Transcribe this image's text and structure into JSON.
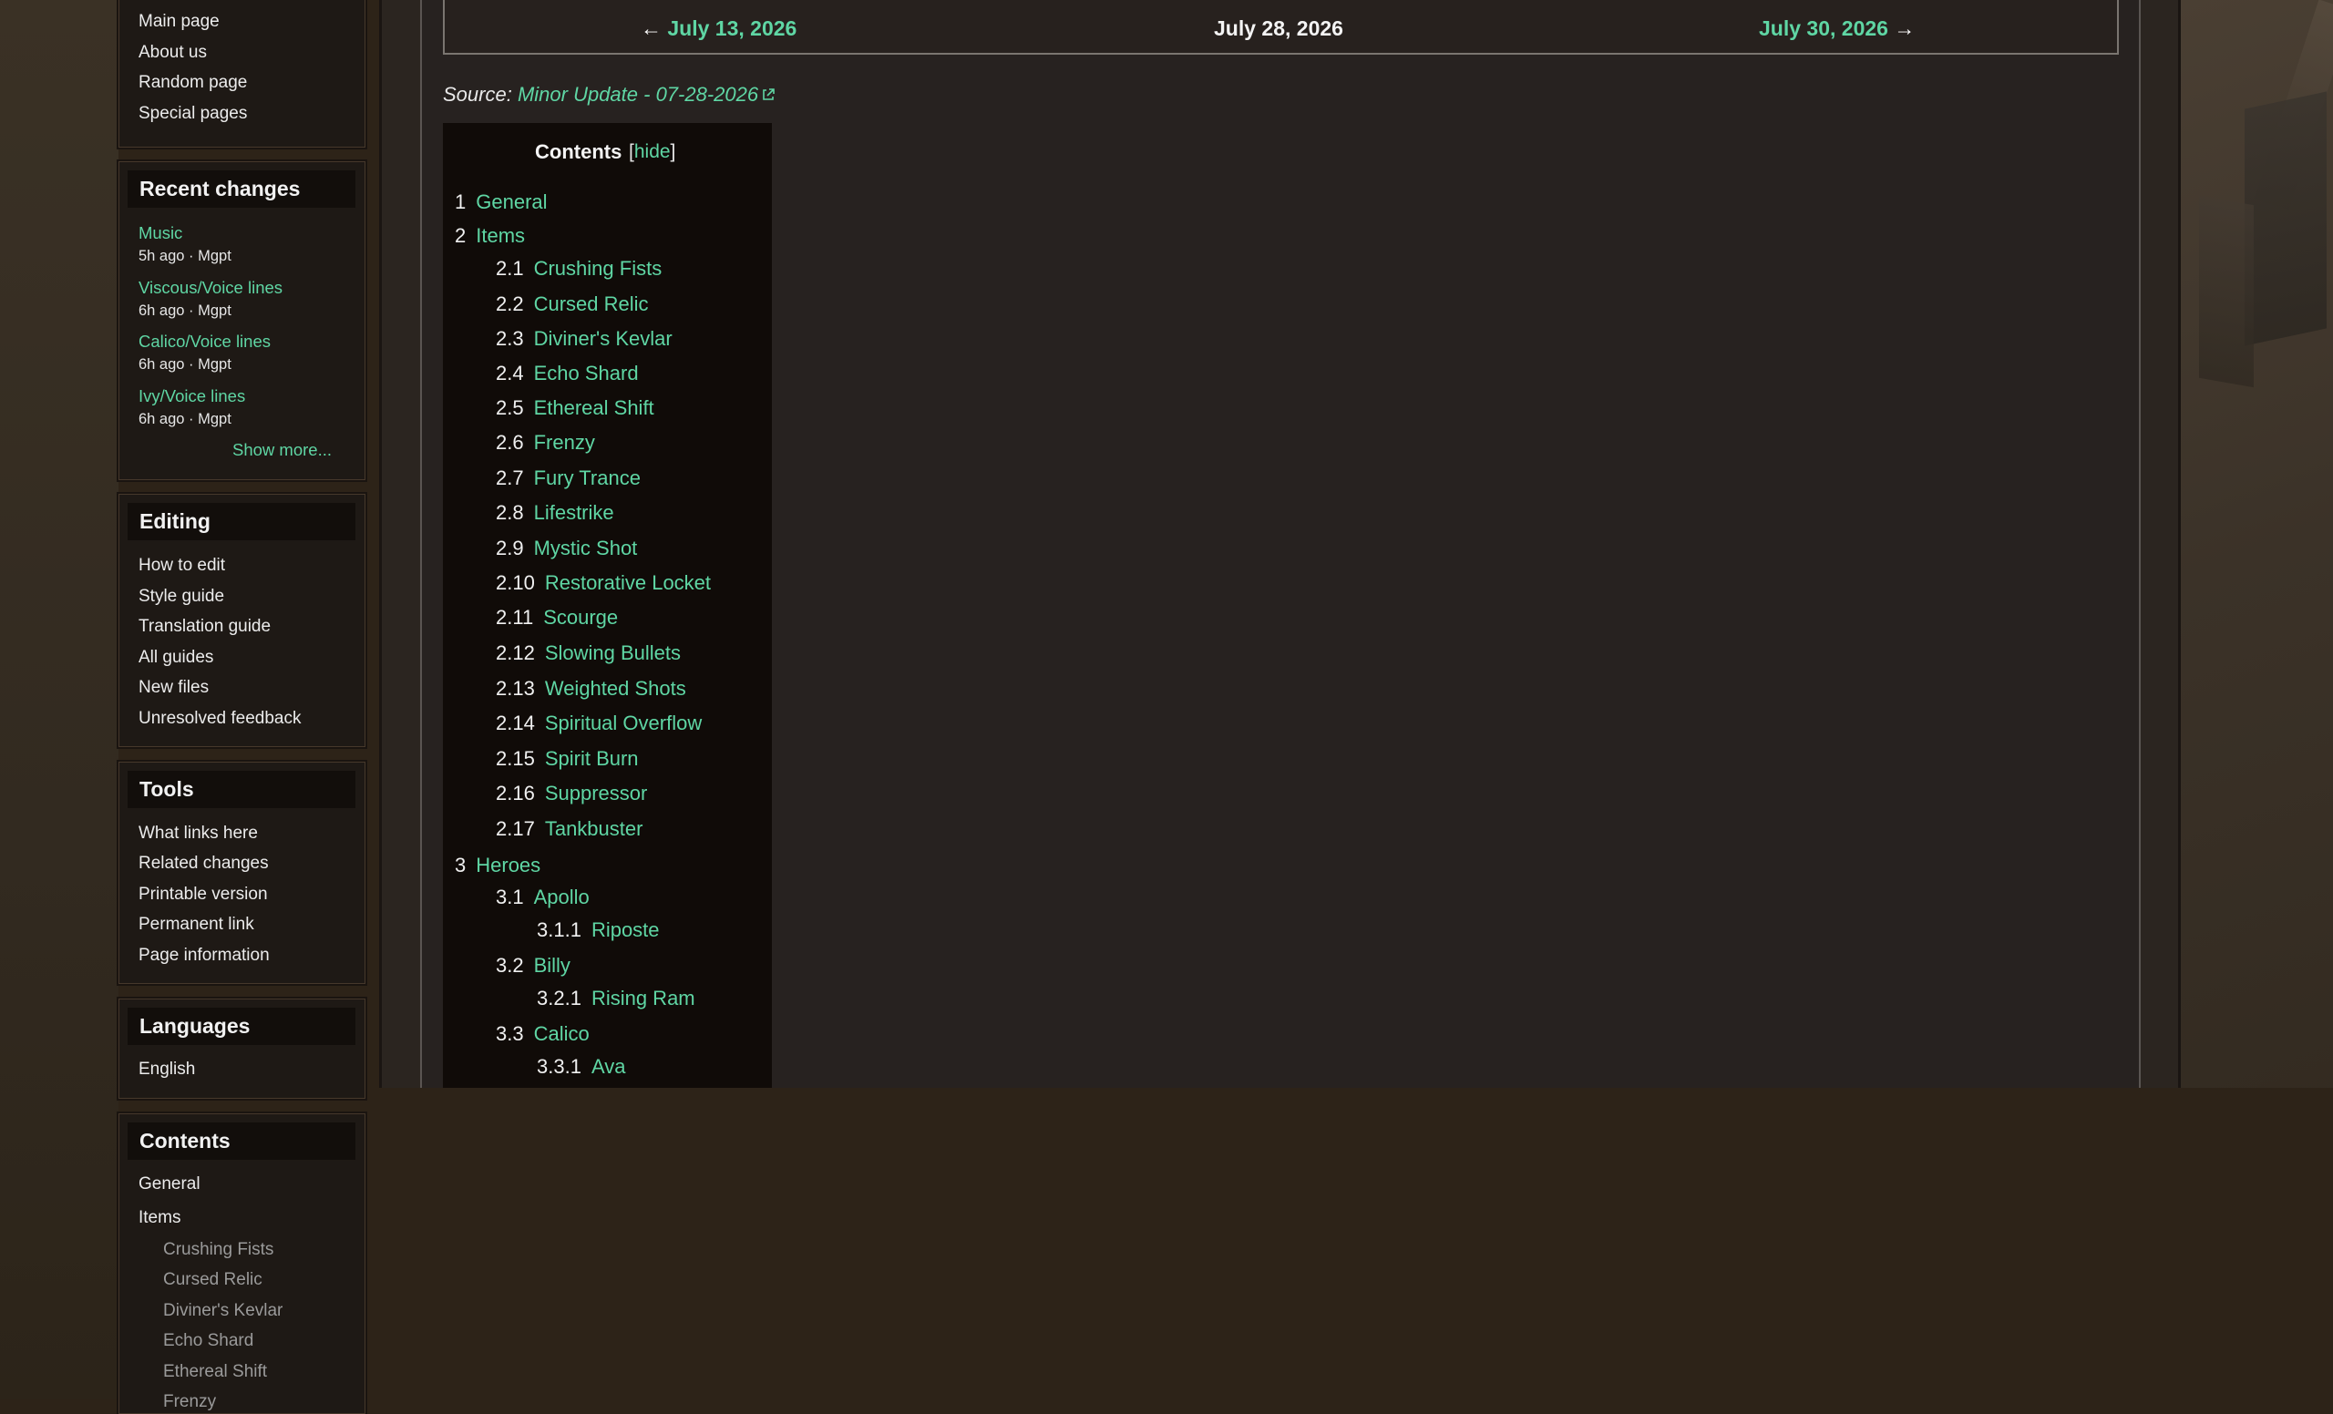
{
  "sidebar": {
    "navigation": {
      "items": [
        "Main page",
        "About us",
        "Random page",
        "Special pages"
      ]
    },
    "recent_changes": {
      "title": "Recent changes",
      "items": [
        {
          "page": "Music",
          "meta": "5h ago · Mgpt"
        },
        {
          "page": "Viscous/Voice lines",
          "meta": "6h ago · Mgpt"
        },
        {
          "page": "Calico/Voice lines",
          "meta": "6h ago · Mgpt"
        },
        {
          "page": "Ivy/Voice lines",
          "meta": "6h ago · Mgpt"
        }
      ],
      "show_more": "Show more..."
    },
    "editing": {
      "title": "Editing",
      "items": [
        "How to edit",
        "Style guide",
        "Translation guide",
        "All guides",
        "New files",
        "Unresolved feedback"
      ]
    },
    "tools": {
      "title": "Tools",
      "items": [
        "What links here",
        "Related changes",
        "Printable version",
        "Permanent link",
        "Page information"
      ]
    },
    "languages": {
      "title": "Languages",
      "items": [
        "English"
      ]
    },
    "contents": {
      "title": "Contents",
      "items": [
        "General",
        "Items"
      ],
      "sub_items": [
        "Crushing Fists",
        "Cursed Relic",
        "Diviner's Kevlar",
        "Echo Shard",
        "Ethereal Shift",
        "Frenzy"
      ]
    }
  },
  "nav": {
    "prev_arrow": "←",
    "prev": "July 13, 2026",
    "current": "July 28, 2026",
    "next": "July 30, 2026",
    "next_arrow": "→"
  },
  "source": {
    "label": "Source:",
    "link": "Minor Update - 07-28-2026"
  },
  "toc": {
    "title": "Contents",
    "hide_open": "[",
    "hide": "hide",
    "hide_close": "]",
    "entries": [
      {
        "num": "1",
        "text": "General"
      },
      {
        "num": "2",
        "text": "Items"
      },
      {
        "num": "2.1",
        "text": "Crushing Fists"
      },
      {
        "num": "2.2",
        "text": "Cursed Relic"
      },
      {
        "num": "2.3",
        "text": "Diviner's Kevlar"
      },
      {
        "num": "2.4",
        "text": "Echo Shard"
      },
      {
        "num": "2.5",
        "text": "Ethereal Shift"
      },
      {
        "num": "2.6",
        "text": "Frenzy"
      },
      {
        "num": "2.7",
        "text": "Fury Trance"
      },
      {
        "num": "2.8",
        "text": "Lifestrike"
      },
      {
        "num": "2.9",
        "text": "Mystic Shot"
      },
      {
        "num": "2.10",
        "text": "Restorative Locket"
      },
      {
        "num": "2.11",
        "text": "Scourge"
      },
      {
        "num": "2.12",
        "text": "Slowing Bullets"
      },
      {
        "num": "2.13",
        "text": "Weighted Shots"
      },
      {
        "num": "2.14",
        "text": "Spiritual Overflow"
      },
      {
        "num": "2.15",
        "text": "Spirit Burn"
      },
      {
        "num": "2.16",
        "text": "Suppressor"
      },
      {
        "num": "2.17",
        "text": "Tankbuster"
      },
      {
        "num": "3",
        "text": "Heroes"
      },
      {
        "num": "3.1",
        "text": "Apollo"
      },
      {
        "num": "3.1.1",
        "text": "Riposte"
      },
      {
        "num": "3.2",
        "text": "Billy"
      },
      {
        "num": "3.2.1",
        "text": "Rising Ram"
      },
      {
        "num": "3.3",
        "text": "Calico"
      },
      {
        "num": "3.3.1",
        "text": "Ava"
      }
    ]
  }
}
